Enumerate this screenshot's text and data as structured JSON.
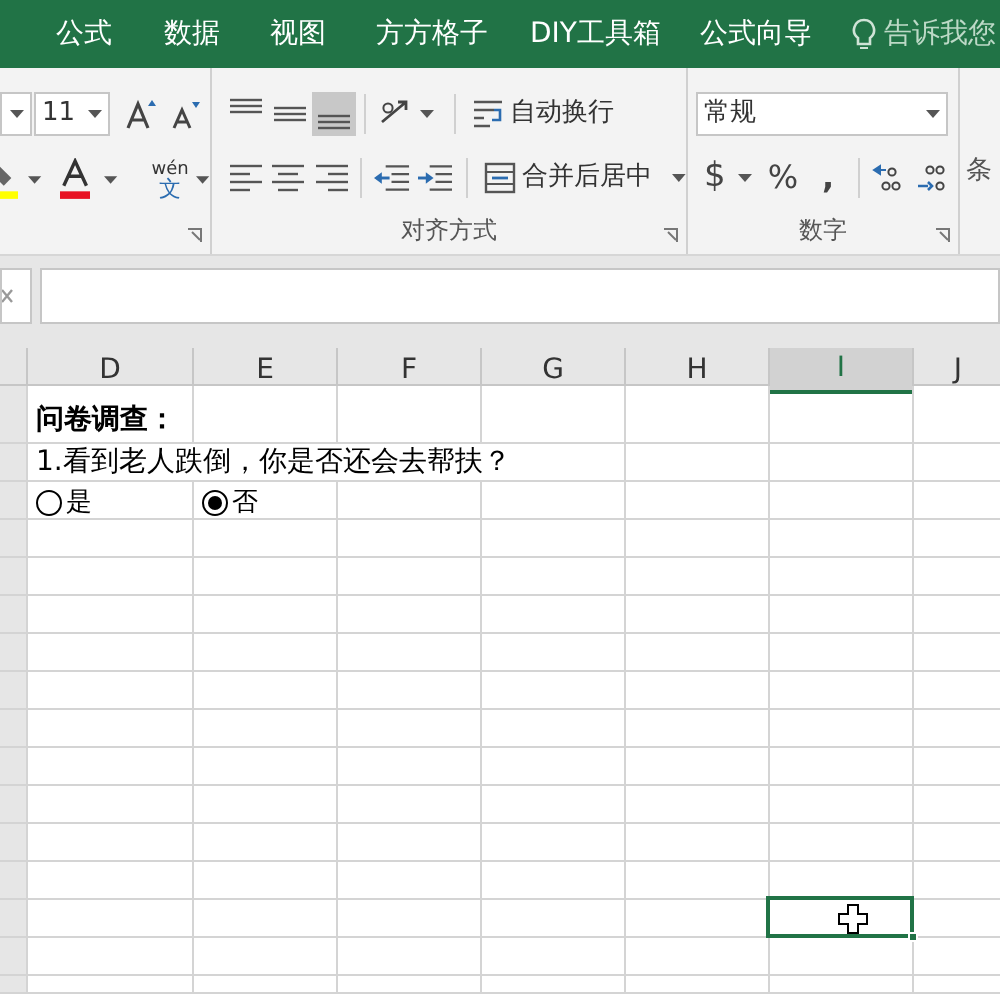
{
  "ribbon_tabs": [
    {
      "label": "公式"
    },
    {
      "label": "数据"
    },
    {
      "label": "视图"
    },
    {
      "label": "方方格子"
    },
    {
      "label": "DIY工具箱"
    },
    {
      "label": "公式向导"
    }
  ],
  "tell_me": {
    "placeholder": "告诉我您"
  },
  "font_group": {
    "font_size": "11",
    "phonetic_top": "wén",
    "phonetic_bottom": "文"
  },
  "alignment_group": {
    "label": "对齐方式",
    "vertical_align": [
      {
        "selected": false
      },
      {
        "selected": false
      },
      {
        "selected": true
      }
    ],
    "wrap_text": "自动换行",
    "merge_center": "合并后居中"
  },
  "number_group": {
    "label": "数字",
    "format": "常规",
    "currency": "$",
    "percent": "%",
    "comma": ","
  },
  "next_group_label": "条",
  "columns": [
    {
      "label": "D",
      "selected": false
    },
    {
      "label": "E",
      "selected": false
    },
    {
      "label": "F",
      "selected": false
    },
    {
      "label": "G",
      "selected": false
    },
    {
      "label": "H",
      "selected": false
    },
    {
      "label": "I",
      "selected": true
    },
    {
      "label": "J",
      "selected": false
    }
  ],
  "title_cell": "问卷调查：",
  "question_cell": "1.看到老人跌倒，你是否还会去帮扶？",
  "options": [
    {
      "label": "是",
      "selected": false
    },
    {
      "label": "否",
      "selected": true
    }
  ]
}
